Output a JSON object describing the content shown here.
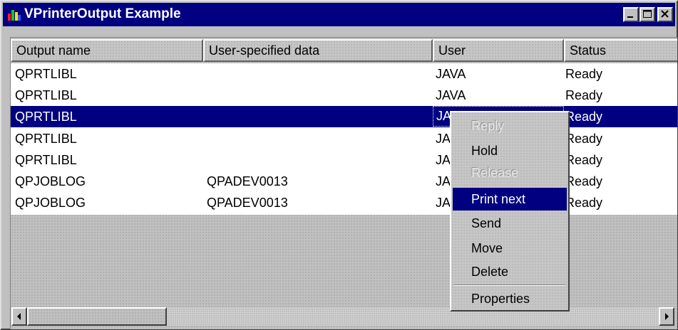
{
  "window": {
    "title": "VPrinterOutput Example"
  },
  "table": {
    "columns": [
      "Output name",
      "User-specified data",
      "User",
      "Status"
    ],
    "rows": [
      {
        "output_name": "QPRTLIBL",
        "user_data": "",
        "user": "JAVA",
        "status": "Ready"
      },
      {
        "output_name": "QPRTLIBL",
        "user_data": "",
        "user": "JAVA",
        "status": "Ready"
      },
      {
        "output_name": "QPRTLIBL",
        "user_data": "",
        "user": "JAVA",
        "status": "Ready",
        "selected": true
      },
      {
        "output_name": "QPRTLIBL",
        "user_data": "",
        "user": "JAVA",
        "status": "Ready"
      },
      {
        "output_name": "QPRTLIBL",
        "user_data": "",
        "user": "JAVA",
        "status": "Ready"
      },
      {
        "output_name": "QPJOBLOG",
        "user_data": "QPADEV0013",
        "user": "JAVA",
        "status": "Ready"
      },
      {
        "output_name": "QPJOBLOG",
        "user_data": "QPADEV0013",
        "user": "JAVA",
        "status": "Ready"
      }
    ]
  },
  "context_menu": {
    "items": [
      {
        "label": "Reply",
        "enabled": false
      },
      {
        "label": "Hold",
        "enabled": true
      },
      {
        "label": "Release",
        "enabled": false
      },
      {
        "label": "Print next",
        "enabled": true,
        "highlighted": true
      },
      {
        "label": "Send",
        "enabled": true
      },
      {
        "label": "Move",
        "enabled": true
      },
      {
        "label": "Delete",
        "enabled": true
      },
      {
        "label": "Properties",
        "enabled": true
      }
    ]
  },
  "colors": {
    "title_bar": "#000080",
    "selection": "#000080"
  },
  "icons": [
    "app-icon",
    "minimize-icon",
    "maximize-icon",
    "close-icon",
    "scroll-left-icon",
    "scroll-right-icon"
  ]
}
